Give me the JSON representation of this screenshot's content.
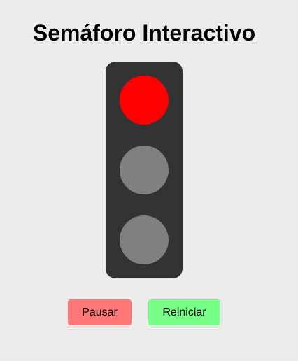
{
  "title": "Semáforo Interactivo",
  "traffic_light": {
    "active_light": "red",
    "colors": {
      "housing": "#333333",
      "off": "#808080",
      "red_on": "#ff0000",
      "yellow_on": "#ffff00",
      "green_on": "#00ff00"
    }
  },
  "controls": {
    "pause_label": "Pausar",
    "reset_label": "Reiniciar",
    "pause_color": "#ff7777",
    "reset_color": "#77ff88"
  }
}
